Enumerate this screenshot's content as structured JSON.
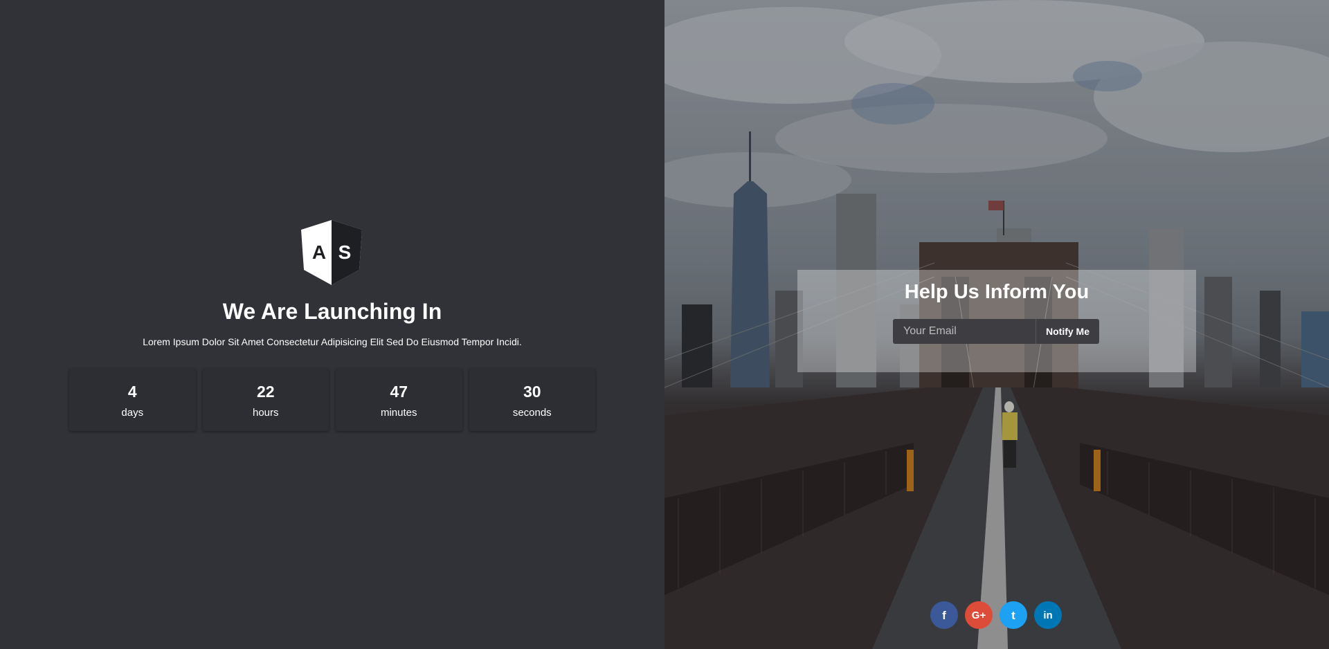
{
  "logo": {
    "letters": [
      "A",
      "S"
    ],
    "icon": "shield-logo-icon"
  },
  "hero": {
    "title": "We Are Launching In",
    "subtitle": "Lorem Ipsum Dolor Sit Amet Consectetur Adipisicing Elit Sed Do Eiusmod Tempor Incidi."
  },
  "countdown": [
    {
      "value": "4",
      "label": "days"
    },
    {
      "value": "22",
      "label": "hours"
    },
    {
      "value": "47",
      "label": "minutes"
    },
    {
      "value": "30",
      "label": "seconds"
    }
  ],
  "inform": {
    "title": "Help Us Inform You",
    "email_placeholder": "Your Email",
    "email_value": "",
    "button_label": "Notify Me"
  },
  "social": [
    {
      "name": "facebook",
      "icon": "facebook-icon",
      "glyph": "f",
      "color": "#3b5998"
    },
    {
      "name": "google-plus",
      "icon": "google-plus-icon",
      "glyph": "G+",
      "color": "#dd4b39"
    },
    {
      "name": "twitter",
      "icon": "twitter-icon",
      "glyph": "t",
      "color": "#1da1f2"
    },
    {
      "name": "linkedin",
      "icon": "linkedin-icon",
      "glyph": "in",
      "color": "#0077b5"
    }
  ],
  "colors": {
    "left_bg": "#313237",
    "box_bg": "#2d2e33",
    "text": "#ffffff"
  }
}
